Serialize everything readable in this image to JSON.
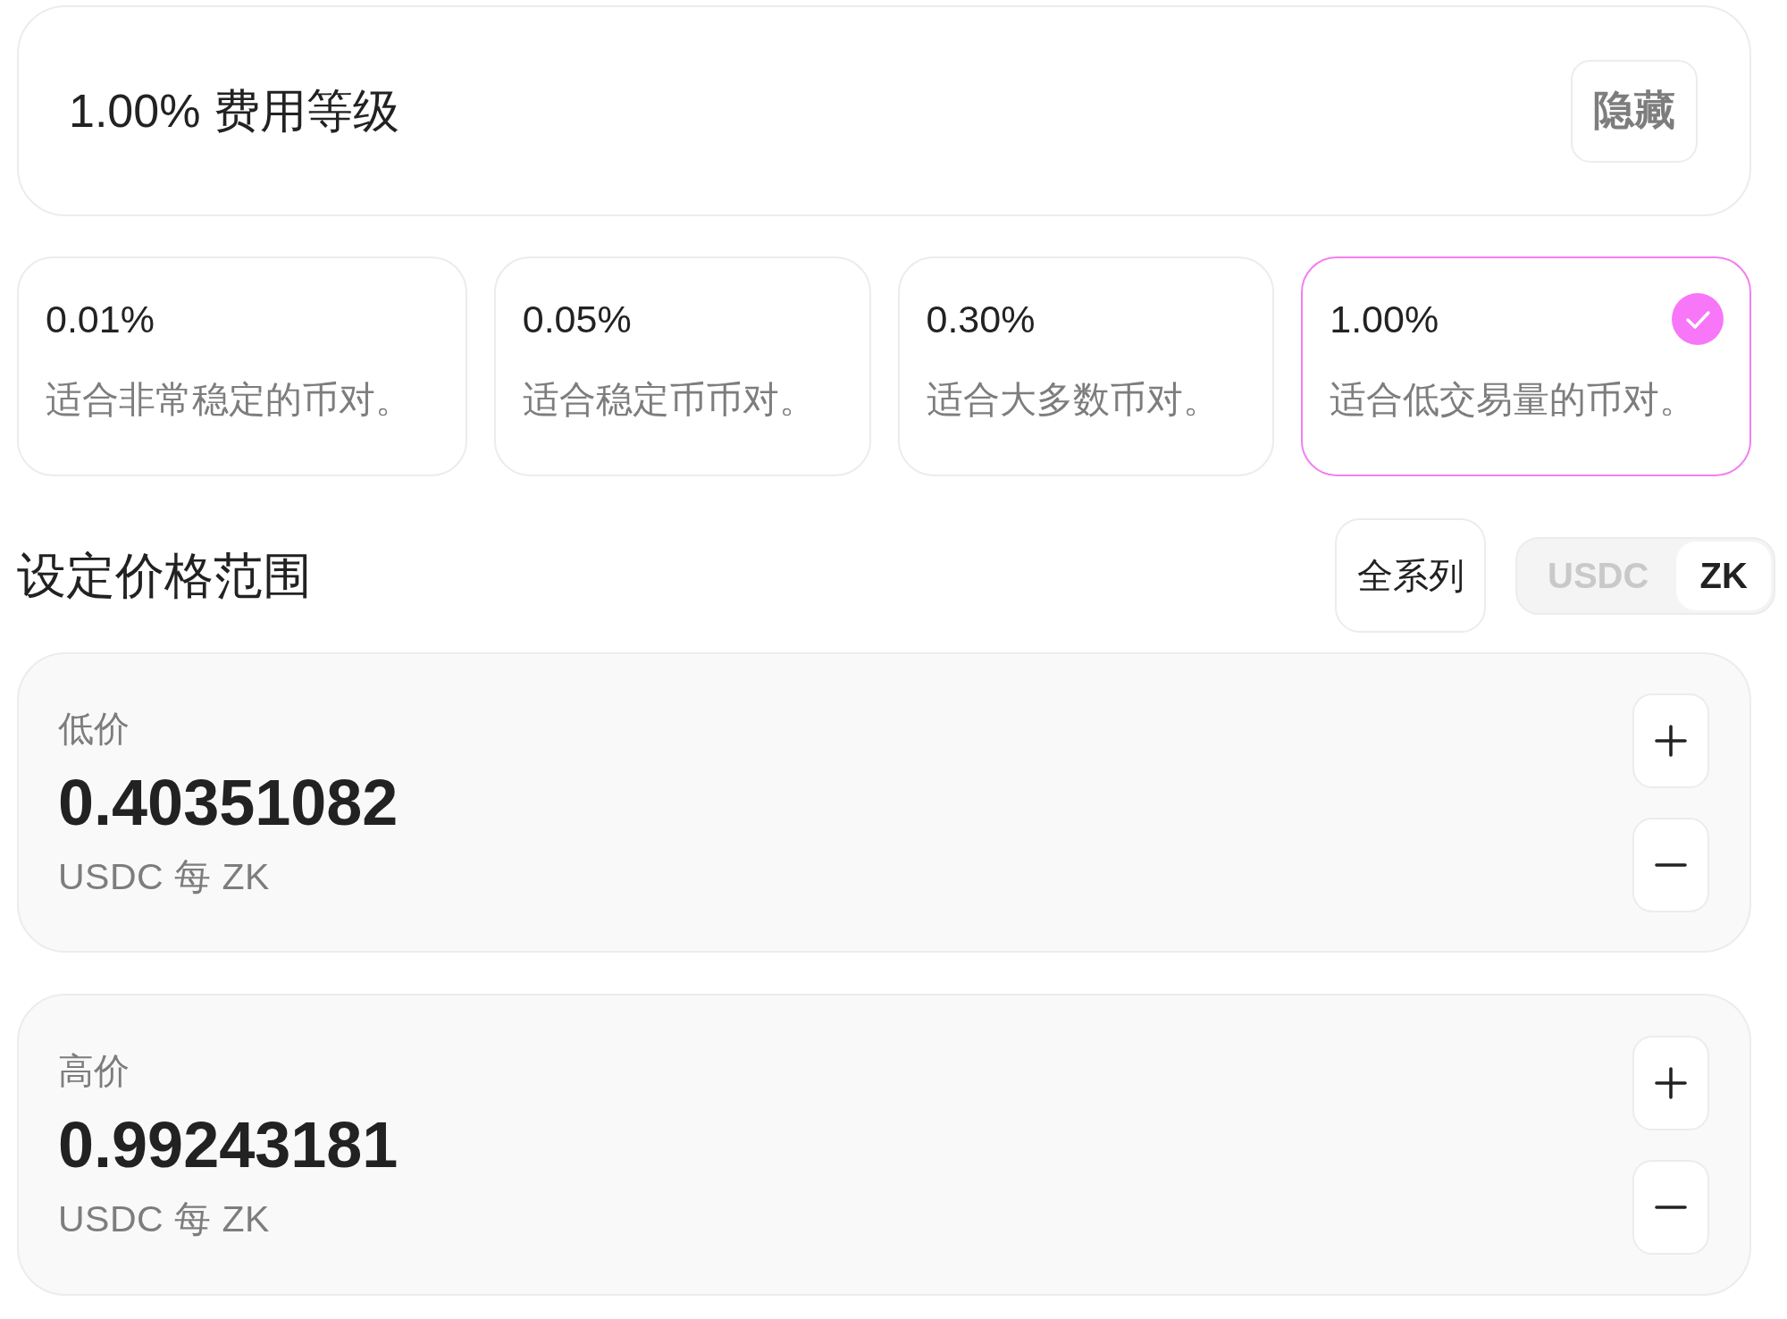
{
  "fee_tier_panel": {
    "title": "1.00% 费用等级",
    "hide_button": "隐藏"
  },
  "fee_tiers": [
    {
      "rate": "0.01%",
      "description": "适合非常稳定的币对。",
      "selected": false
    },
    {
      "rate": "0.05%",
      "description": "适合稳定币币对。",
      "selected": false
    },
    {
      "rate": "0.30%",
      "description": "适合大多数币对。",
      "selected": false
    },
    {
      "rate": "1.00%",
      "description": "适合低交易量的币对。",
      "selected": true
    }
  ],
  "price_range": {
    "title": "设定价格范围",
    "full_range_button": "全系列",
    "token_toggle": [
      {
        "label": "USDC",
        "selected": false
      },
      {
        "label": "ZK",
        "selected": true
      }
    ]
  },
  "price_inputs": [
    {
      "label": "低价",
      "value": "0.40351082",
      "unit": "USDC 每 ZK"
    },
    {
      "label": "高价",
      "value": "0.99243181",
      "unit": "USDC 每 ZK"
    }
  ]
}
